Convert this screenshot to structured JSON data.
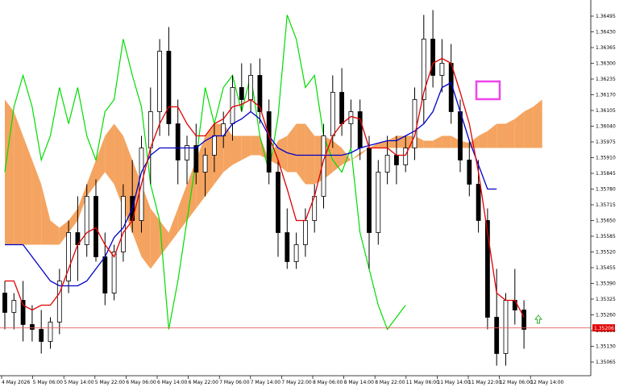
{
  "chart_data": {
    "type": "candlestick",
    "title": "",
    "xlabel": "",
    "ylabel": "",
    "ylim": [
      1.35,
      1.3655
    ],
    "grid": false,
    "legend": "none",
    "y_ticks": [
      "1.36495",
      "1.36430",
      "1.36365",
      "1.36300",
      "1.36235",
      "1.36170",
      "1.36105",
      "1.36040",
      "1.35975",
      "1.35910",
      "1.35845",
      "1.35780",
      "1.35715",
      "1.35650",
      "1.35585",
      "1.35520",
      "1.35455",
      "1.35390",
      "1.35325",
      "1.35260",
      "1.35195",
      "1.35130",
      "1.35065"
    ],
    "x_ticks": [
      "4 May 2026",
      "5 May 06:00",
      "5 May 14:00",
      "5 May 22:00",
      "6 May 06:00",
      "6 May 14:00",
      "6 May 22:00",
      "7 May 06:00",
      "7 May 14:00",
      "7 May 22:00",
      "8 May 06:00",
      "8 May 14:00",
      "8 May 22:00",
      "11 May 06:00",
      "11 May 14:00",
      "11 May 22:00",
      "12 May 06:00",
      "12 May 14:00"
    ],
    "current_price": "1.35206",
    "colors": {
      "background": "#ffffff",
      "candle": "#000000",
      "tenkan": "#e00000",
      "kijun": "#0000c8",
      "chikou": "#00dd00",
      "cloud_bullish": "#f4a460",
      "cloud_bearish": "#d8bfd8",
      "price_line": "#e06060",
      "price_box": "#e00000",
      "highlight": "#ee44ee",
      "arrow": "#22aa22"
    },
    "candles": [
      [
        1.3535,
        1.354,
        1.352,
        1.3527
      ],
      [
        1.3527,
        1.3535,
        1.352,
        1.3532
      ],
      [
        1.3532,
        1.354,
        1.3515,
        1.3522
      ],
      [
        1.3522,
        1.353,
        1.3515,
        1.352
      ],
      [
        1.352,
        1.3528,
        1.351,
        1.3515
      ],
      [
        1.3515,
        1.3525,
        1.3512,
        1.3523
      ],
      [
        1.3523,
        1.3545,
        1.3518,
        1.354
      ],
      [
        1.354,
        1.3565,
        1.3535,
        1.356
      ],
      [
        1.356,
        1.3575,
        1.354,
        1.3555
      ],
      [
        1.3555,
        1.358,
        1.355,
        1.3575
      ],
      [
        1.3575,
        1.3582,
        1.3548,
        1.355
      ],
      [
        1.355,
        1.356,
        1.353,
        1.3535
      ],
      [
        1.3535,
        1.3555,
        1.3532,
        1.3552
      ],
      [
        1.3552,
        1.358,
        1.3548,
        1.3575
      ],
      [
        1.3575,
        1.359,
        1.356,
        1.3565
      ],
      [
        1.3565,
        1.36,
        1.356,
        1.3595
      ],
      [
        1.3595,
        1.362,
        1.358,
        1.361
      ],
      [
        1.361,
        1.364,
        1.36,
        1.3635
      ],
      [
        1.3635,
        1.3645,
        1.36,
        1.3605
      ],
      [
        1.3605,
        1.3615,
        1.358,
        1.359
      ],
      [
        1.359,
        1.36,
        1.358,
        1.3596
      ],
      [
        1.3596,
        1.3605,
        1.358,
        1.3585
      ],
      [
        1.3585,
        1.3595,
        1.3575,
        1.3592
      ],
      [
        1.3592,
        1.3605,
        1.3585,
        1.36
      ],
      [
        1.36,
        1.361,
        1.3595,
        1.3605
      ],
      [
        1.3605,
        1.3625,
        1.3598,
        1.362
      ],
      [
        1.362,
        1.363,
        1.361,
        1.3615
      ],
      [
        1.3615,
        1.363,
        1.361,
        1.3625
      ],
      [
        1.3625,
        1.3632,
        1.3605,
        1.361
      ],
      [
        1.361,
        1.3615,
        1.358,
        1.3585
      ],
      [
        1.3585,
        1.359,
        1.355,
        1.356
      ],
      [
        1.356,
        1.357,
        1.3545,
        1.3548
      ],
      [
        1.3548,
        1.356,
        1.3545,
        1.3555
      ],
      [
        1.3555,
        1.357,
        1.355,
        1.3565
      ],
      [
        1.3565,
        1.358,
        1.356,
        1.3575
      ],
      [
        1.3575,
        1.3605,
        1.357,
        1.36
      ],
      [
        1.36,
        1.3625,
        1.3595,
        1.3618
      ],
      [
        1.3618,
        1.3628,
        1.36,
        1.3605
      ],
      [
        1.3605,
        1.3615,
        1.3595,
        1.361
      ],
      [
        1.361,
        1.3615,
        1.359,
        1.3595
      ],
      [
        1.3595,
        1.36,
        1.3545,
        1.356
      ],
      [
        1.356,
        1.359,
        1.3555,
        1.3585
      ],
      [
        1.3585,
        1.36,
        1.358,
        1.3592
      ],
      [
        1.3592,
        1.36,
        1.358,
        1.3588
      ],
      [
        1.3588,
        1.36,
        1.3585,
        1.3595
      ],
      [
        1.3595,
        1.362,
        1.359,
        1.3615
      ],
      [
        1.3615,
        1.365,
        1.3605,
        1.364
      ],
      [
        1.364,
        1.3652,
        1.362,
        1.3625
      ],
      [
        1.3625,
        1.364,
        1.3618,
        1.363
      ],
      [
        1.363,
        1.3638,
        1.3605,
        1.361
      ],
      [
        1.361,
        1.3615,
        1.3585,
        1.359
      ],
      [
        1.359,
        1.3598,
        1.3575,
        1.358
      ],
      [
        1.358,
        1.359,
        1.356,
        1.3565
      ],
      [
        1.3565,
        1.357,
        1.352,
        1.3525
      ],
      [
        1.3525,
        1.3545,
        1.3505,
        1.351
      ],
      [
        1.351,
        1.3535,
        1.3505,
        1.3532
      ],
      [
        1.3532,
        1.3545,
        1.3522,
        1.3528
      ],
      [
        1.3528,
        1.3532,
        1.3512,
        1.352
      ]
    ],
    "tenkan": [
      1.354,
      1.354,
      1.353,
      1.3528,
      1.353,
      1.353,
      1.3535,
      1.3545,
      1.3555,
      1.356,
      1.3562,
      1.3555,
      1.355,
      1.356,
      1.3565,
      1.358,
      1.3595,
      1.3605,
      1.3612,
      1.3612,
      1.3605,
      1.36,
      1.36,
      1.3605,
      1.3607,
      1.3612,
      1.3613,
      1.3615,
      1.3612,
      1.36,
      1.359,
      1.3578,
      1.3565,
      1.3565,
      1.3575,
      1.359,
      1.36,
      1.3605,
      1.3608,
      1.3607,
      1.3595,
      1.3595,
      1.3595,
      1.3592,
      1.3592,
      1.36,
      1.3618,
      1.363,
      1.3632,
      1.363,
      1.3618,
      1.3605,
      1.3585,
      1.356,
      1.3535,
      1.3532,
      1.3532,
      1.3525
    ],
    "kijun": [
      1.3555,
      1.3555,
      1.3555,
      1.355,
      1.3545,
      1.354,
      1.3538,
      1.3538,
      1.3538,
      1.354,
      1.3545,
      1.355,
      1.3558,
      1.3562,
      1.357,
      1.3585,
      1.3592,
      1.3595,
      1.3595,
      1.3595,
      1.3595,
      1.3595,
      1.3598,
      1.36,
      1.36,
      1.3605,
      1.3607,
      1.361,
      1.3607,
      1.36,
      1.3595,
      1.3593,
      1.3592,
      1.3592,
      1.3592,
      1.3592,
      1.3592,
      1.3592,
      1.3593,
      1.3595,
      1.3596,
      1.3597,
      1.3598,
      1.3598,
      1.36,
      1.3602,
      1.3605,
      1.361,
      1.362,
      1.3622,
      1.361,
      1.3598,
      1.3588,
      1.3578,
      1.3578
    ],
    "chikou": [
      1.3585,
      1.3612,
      1.3625,
      1.3612,
      1.359,
      1.36,
      1.362,
      1.3605,
      1.362,
      1.36,
      1.359,
      1.361,
      1.3615,
      1.364,
      1.3625,
      1.3612,
      1.358,
      1.3565,
      1.352,
      1.354,
      1.3565,
      1.359,
      1.362,
      1.3605,
      1.362,
      1.3625,
      1.361,
      1.3625,
      1.36,
      1.3585,
      1.3608,
      1.365,
      1.364,
      1.362,
      1.3625,
      1.36,
      1.359,
      1.3585,
      1.3595,
      1.356,
      1.3545,
      1.353,
      1.352,
      1.3525,
      1.353
    ],
    "cloud_a": [
      1.3615,
      1.361,
      1.36,
      1.359,
      1.358,
      1.3565,
      1.3562,
      1.3565,
      1.357,
      1.358,
      1.359,
      1.36,
      1.3605,
      1.36,
      1.359,
      1.358,
      1.357,
      1.3565,
      1.356,
      1.357,
      1.358,
      1.359,
      1.36,
      1.3605,
      1.3605,
      1.36,
      1.36,
      1.36,
      1.36,
      1.359,
      1.3598,
      1.36,
      1.3605,
      1.3605,
      1.36,
      1.36,
      1.3598,
      1.3595,
      1.359,
      1.3593,
      1.3595,
      1.3597,
      1.3598,
      1.36,
      1.36,
      1.36,
      1.3598,
      1.3598,
      1.36,
      1.36,
      1.3598,
      1.3597,
      1.36,
      1.3602,
      1.3605,
      1.3605,
      1.3607,
      1.361,
      1.3612,
      1.3615
    ],
    "cloud_b": [
      1.3555,
      1.3555,
      1.3555,
      1.3555,
      1.3555,
      1.3555,
      1.3555,
      1.356,
      1.3565,
      1.3575,
      1.358,
      1.3585,
      1.358,
      1.357,
      1.356,
      1.355,
      1.3545,
      1.355,
      1.3555,
      1.356,
      1.3565,
      1.357,
      1.3575,
      1.358,
      1.3585,
      1.3588,
      1.359,
      1.3592,
      1.3592,
      1.359,
      1.3588,
      1.3585,
      1.3585,
      1.358,
      1.358,
      1.3582,
      1.3585,
      1.3588,
      1.359,
      1.3592,
      1.3595,
      1.3595,
      1.3595,
      1.3595,
      1.3595,
      1.3595,
      1.3595,
      1.3595,
      1.3595,
      1.3595,
      1.3595,
      1.3595,
      1.3595,
      1.3595,
      1.3595,
      1.3595,
      1.3595,
      1.3595,
      1.3595,
      1.3595
    ]
  }
}
